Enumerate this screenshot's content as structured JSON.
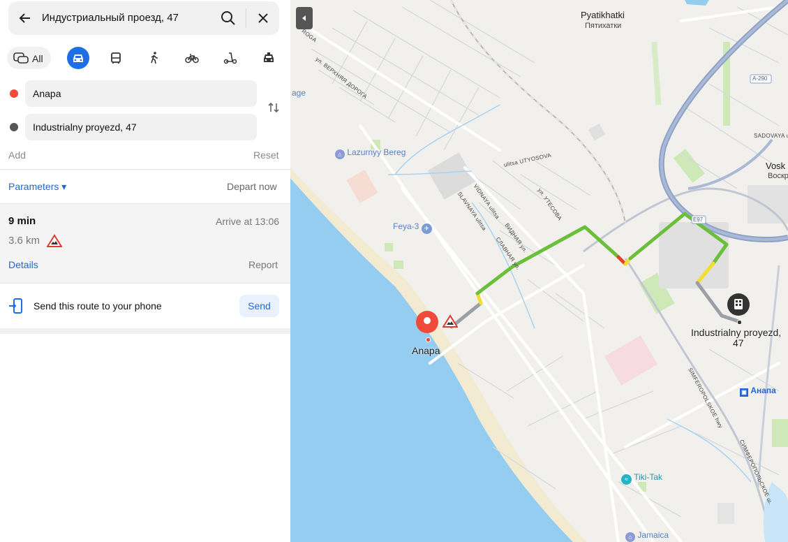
{
  "search": {
    "query": "Индустриальный проезд, 47"
  },
  "modes": {
    "all_label": "All"
  },
  "waypoints": [
    {
      "label": "Anapa",
      "color": "#f04a3a"
    },
    {
      "label": "Industrialny proyezd, 47",
      "color": "#555555"
    }
  ],
  "actions": {
    "add": "Add",
    "reset": "Reset"
  },
  "params": {
    "label": "Parameters ▾",
    "depart": "Depart now"
  },
  "route": {
    "time": "9 min",
    "arrive": "Arrive at 13:06",
    "distance": "3.6 km",
    "details": "Details",
    "report": "Report"
  },
  "share": {
    "text": "Send this route to your phone",
    "button": "Send"
  },
  "map": {
    "places": {
      "pyatikhatki_en": "Pyatikhatki",
      "pyatikhatki_ru": "Пятихатки",
      "vosk": "Vosk",
      "voskr": "Воскр",
      "age": "age",
      "lazurnyy": "Lazurnyy Bereg",
      "feya": "Feya-3",
      "tikitak": "Tiki-Tak",
      "jamaica": "Jamaica",
      "anapa_station": "Анапа",
      "a290": "A-290",
      "e97": "E97"
    },
    "streets": {
      "s1": "ул. ВЕРХНЯЯ ДОРОГА",
      "s2": "ROGA",
      "s3": "SADOVAYA ul.",
      "s4": "ulitsa UTYOSOVA",
      "s5": "ул. УТЕСОВА",
      "s6": "VIDNAYA ulitsa",
      "s7": "ВИДНАЯ ул.",
      "s8": "SLAVNAYA ulitsa",
      "s9": "СЛАВНАЯ ул.",
      "s10": "SIMFEROPOLSKOE hwy",
      "s11": "СИМФЕРОПОЛЬСКОЕ ш."
    },
    "start_label": "Anapa",
    "dest_label_1": "Industrialny proyezd,",
    "dest_label_2": "47"
  },
  "colors": {
    "accent": "#1e6ee8",
    "route_green": "#6cbf3a",
    "sea": "#94cdf0",
    "start_pin": "#f04a3a"
  }
}
